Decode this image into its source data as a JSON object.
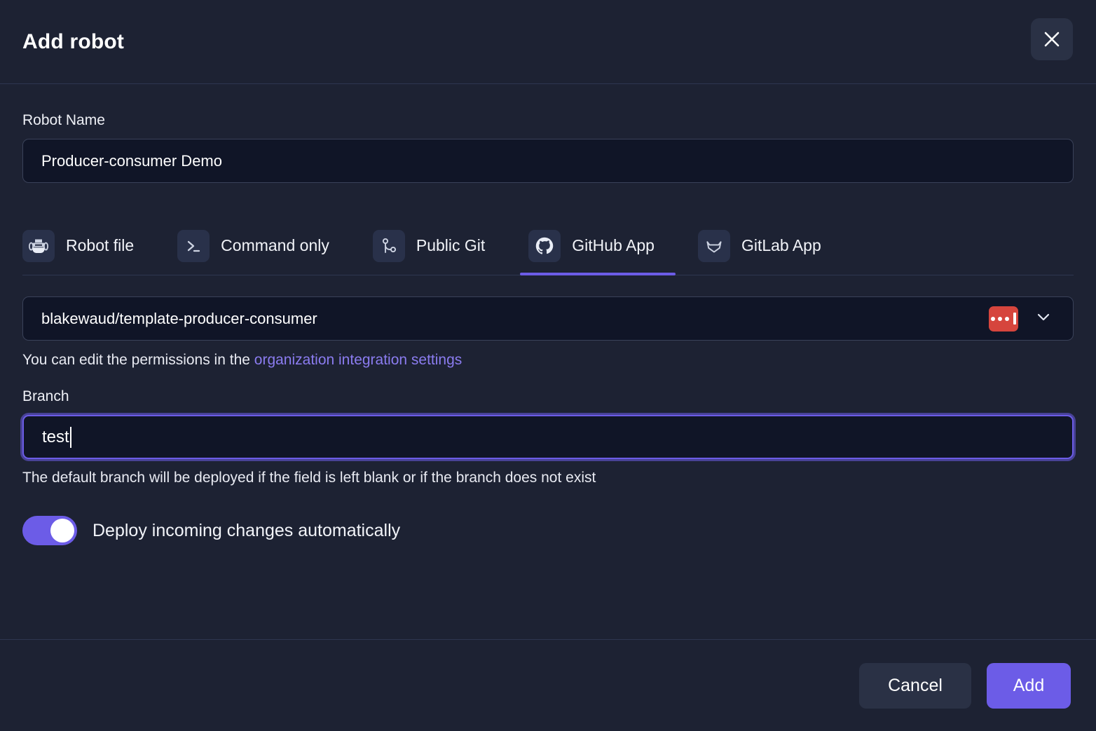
{
  "dialog": {
    "title": "Add robot",
    "close_icon": "close-icon"
  },
  "form": {
    "robot_name": {
      "label": "Robot Name",
      "value": "Producer-consumer Demo",
      "placeholder": "Robot Name"
    },
    "source_tabs": [
      {
        "label": "Robot file",
        "icon": "robot-icon",
        "active": false
      },
      {
        "label": "Command only",
        "icon": "terminal-icon",
        "active": false
      },
      {
        "label": "Public Git",
        "icon": "git-branch-icon",
        "active": false
      },
      {
        "label": "GitHub App",
        "icon": "github-icon",
        "active": true
      },
      {
        "label": "GitLab App",
        "icon": "gitlab-icon",
        "active": false
      }
    ],
    "repository": {
      "value": "blakewaud/template-producer-consumer",
      "badge_icon": "repo-private-badge-icon",
      "chevron_icon": "chevron-down-icon"
    },
    "permissions_help": {
      "prefix": "You can edit the permissions in the ",
      "link": "organization integration settings"
    },
    "branch": {
      "label": "Branch",
      "value": "test",
      "placeholder": "Branch",
      "hint": "The default branch will be deployed if the field is left blank or if the branch does not exist"
    },
    "auto_deploy": {
      "label": "Deploy incoming changes automatically",
      "enabled": "on"
    }
  },
  "footer": {
    "cancel_label": "Cancel",
    "add_label": "Add"
  },
  "colors": {
    "accent": "#6c5ce7",
    "dialog_bg": "#1d2233",
    "input_bg": "#101527",
    "badge_red": "#d6453d",
    "link": "#8b7cf0"
  }
}
